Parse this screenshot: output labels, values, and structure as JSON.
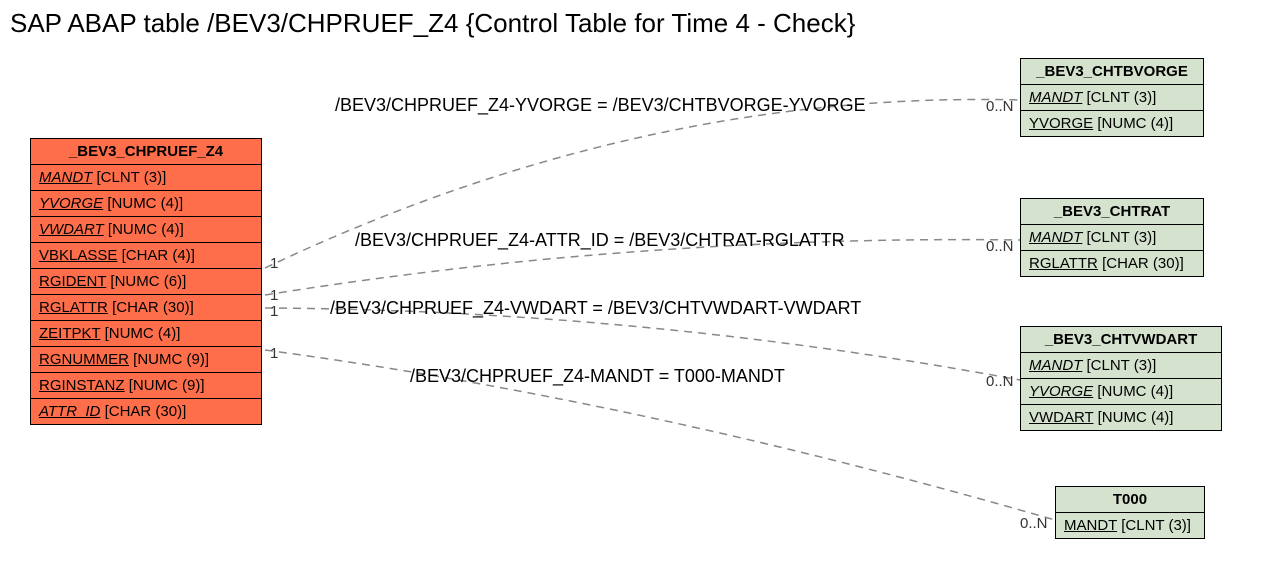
{
  "title": "SAP ABAP table /BEV3/CHPRUEF_Z4 {Control Table for Time 4 - Check}",
  "mainTable": {
    "name": "_BEV3_CHPRUEF_Z4",
    "fields": [
      {
        "name": "MANDT",
        "type": "[CLNT (3)]",
        "italic": true
      },
      {
        "name": "YVORGE",
        "type": "[NUMC (4)]",
        "italic": true
      },
      {
        "name": "VWDART",
        "type": "[NUMC (4)]",
        "italic": true
      },
      {
        "name": "VBKLASSE",
        "type": "[CHAR (4)]",
        "italic": false
      },
      {
        "name": "RGIDENT",
        "type": "[NUMC (6)]",
        "italic": false
      },
      {
        "name": "RGLATTR",
        "type": "[CHAR (30)]",
        "italic": false
      },
      {
        "name": "ZEITPKT",
        "type": "[NUMC (4)]",
        "italic": false
      },
      {
        "name": "RGNUMMER",
        "type": "[NUMC (9)]",
        "italic": false
      },
      {
        "name": "RGINSTANZ",
        "type": "[NUMC (9)]",
        "italic": false
      },
      {
        "name": "ATTR_ID",
        "type": "[CHAR (30)]",
        "italic": true
      }
    ]
  },
  "refTables": {
    "t1": {
      "name": "_BEV3_CHTBVORGE",
      "fields": [
        {
          "name": "MANDT",
          "type": "[CLNT (3)]",
          "italic": true
        },
        {
          "name": "YVORGE",
          "type": "[NUMC (4)]",
          "italic": false
        }
      ]
    },
    "t2": {
      "name": "_BEV3_CHTRAT",
      "fields": [
        {
          "name": "MANDT",
          "type": "[CLNT (3)]",
          "italic": true
        },
        {
          "name": "RGLATTR",
          "type": "[CHAR (30)]",
          "italic": false
        }
      ]
    },
    "t3": {
      "name": "_BEV3_CHTVWDART",
      "fields": [
        {
          "name": "MANDT",
          "type": "[CLNT (3)]",
          "italic": true
        },
        {
          "name": "YVORGE",
          "type": "[NUMC (4)]",
          "italic": true
        },
        {
          "name": "VWDART",
          "type": "[NUMC (4)]",
          "italic": false
        }
      ]
    },
    "t4": {
      "name": "T000",
      "fields": [
        {
          "name": "MANDT",
          "type": "[CLNT (3)]",
          "italic": false
        }
      ]
    }
  },
  "relations": {
    "r1": "/BEV3/CHPRUEF_Z4-YVORGE = /BEV3/CHTBVORGE-YVORGE",
    "r2": "/BEV3/CHPRUEF_Z4-ATTR_ID = /BEV3/CHTRAT-RGLATTR",
    "r3": "/BEV3/CHPRUEF_Z4-VWDART = /BEV3/CHTVWDART-VWDART",
    "r4": "/BEV3/CHPRUEF_Z4-MANDT = T000-MANDT"
  },
  "cardinalities": {
    "left1": "1",
    "left2": "1",
    "left3": "1",
    "left4": "1",
    "right1": "0..N",
    "right2": "0..N",
    "right3": "0..N",
    "right4": "0..N"
  }
}
